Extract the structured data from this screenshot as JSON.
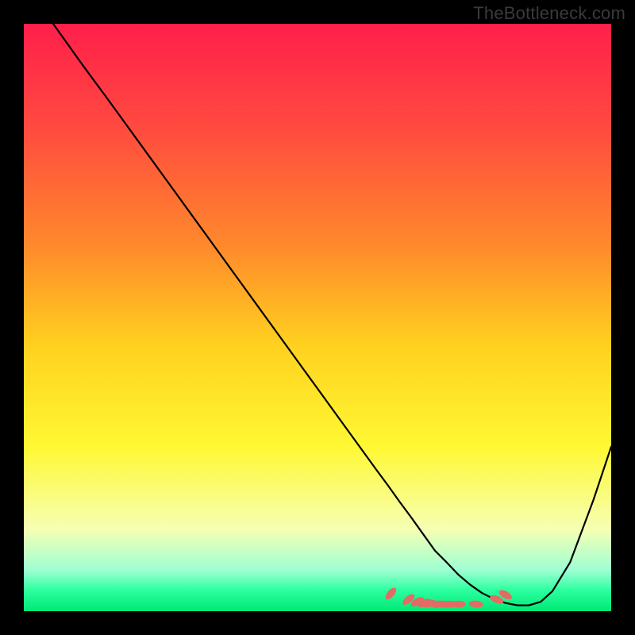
{
  "watermark": "TheBottleneck.com",
  "chart_data": {
    "type": "line",
    "title": "",
    "xlabel": "",
    "ylabel": "",
    "xlim": [
      0,
      100
    ],
    "ylim": [
      0,
      100
    ],
    "gradient_stops": [
      {
        "offset": 0.0,
        "color": "#ff1f4b"
      },
      {
        "offset": 0.18,
        "color": "#ff4b3f"
      },
      {
        "offset": 0.38,
        "color": "#ff8a2b"
      },
      {
        "offset": 0.55,
        "color": "#ffd21f"
      },
      {
        "offset": 0.72,
        "color": "#fff833"
      },
      {
        "offset": 0.86,
        "color": "#f6ffb3"
      },
      {
        "offset": 0.93,
        "color": "#9effd3"
      },
      {
        "offset": 0.965,
        "color": "#2bff9e"
      },
      {
        "offset": 1.0,
        "color": "#00e876"
      }
    ],
    "series": [
      {
        "name": "curve",
        "x": [
          5,
          10,
          15,
          20,
          25,
          30,
          35,
          40,
          45,
          50,
          55,
          60,
          62,
          64,
          66,
          68,
          70,
          72,
          74,
          76,
          78,
          80,
          82,
          84,
          86,
          88,
          90,
          93,
          97,
          100
        ],
        "y": [
          100,
          93,
          86.2,
          79.3,
          72.4,
          65.5,
          58.6,
          51.7,
          44.8,
          37.9,
          31.0,
          24.1,
          21.4,
          18.6,
          15.9,
          13.1,
          10.3,
          8.3,
          6.2,
          4.5,
          3.1,
          2.1,
          1.4,
          1.0,
          1.0,
          1.6,
          3.4,
          8.3,
          19.0,
          28.0
        ]
      }
    ],
    "markers": {
      "x": [
        62.5,
        65.5,
        67.0,
        68.2,
        69.0,
        70.5,
        71.5,
        72.5,
        74.0,
        77.0,
        80.5,
        82.0
      ],
      "y": [
        3.0,
        2.0,
        1.6,
        1.4,
        1.3,
        1.2,
        1.2,
        1.2,
        1.2,
        1.2,
        2.0,
        2.8
      ],
      "rotation_deg": [
        -50,
        -40,
        -30,
        -22,
        -15,
        -8,
        0,
        0,
        0,
        5,
        22,
        30
      ],
      "color": "#e36b63",
      "rx": 6.2,
      "ry": 3.5
    }
  }
}
